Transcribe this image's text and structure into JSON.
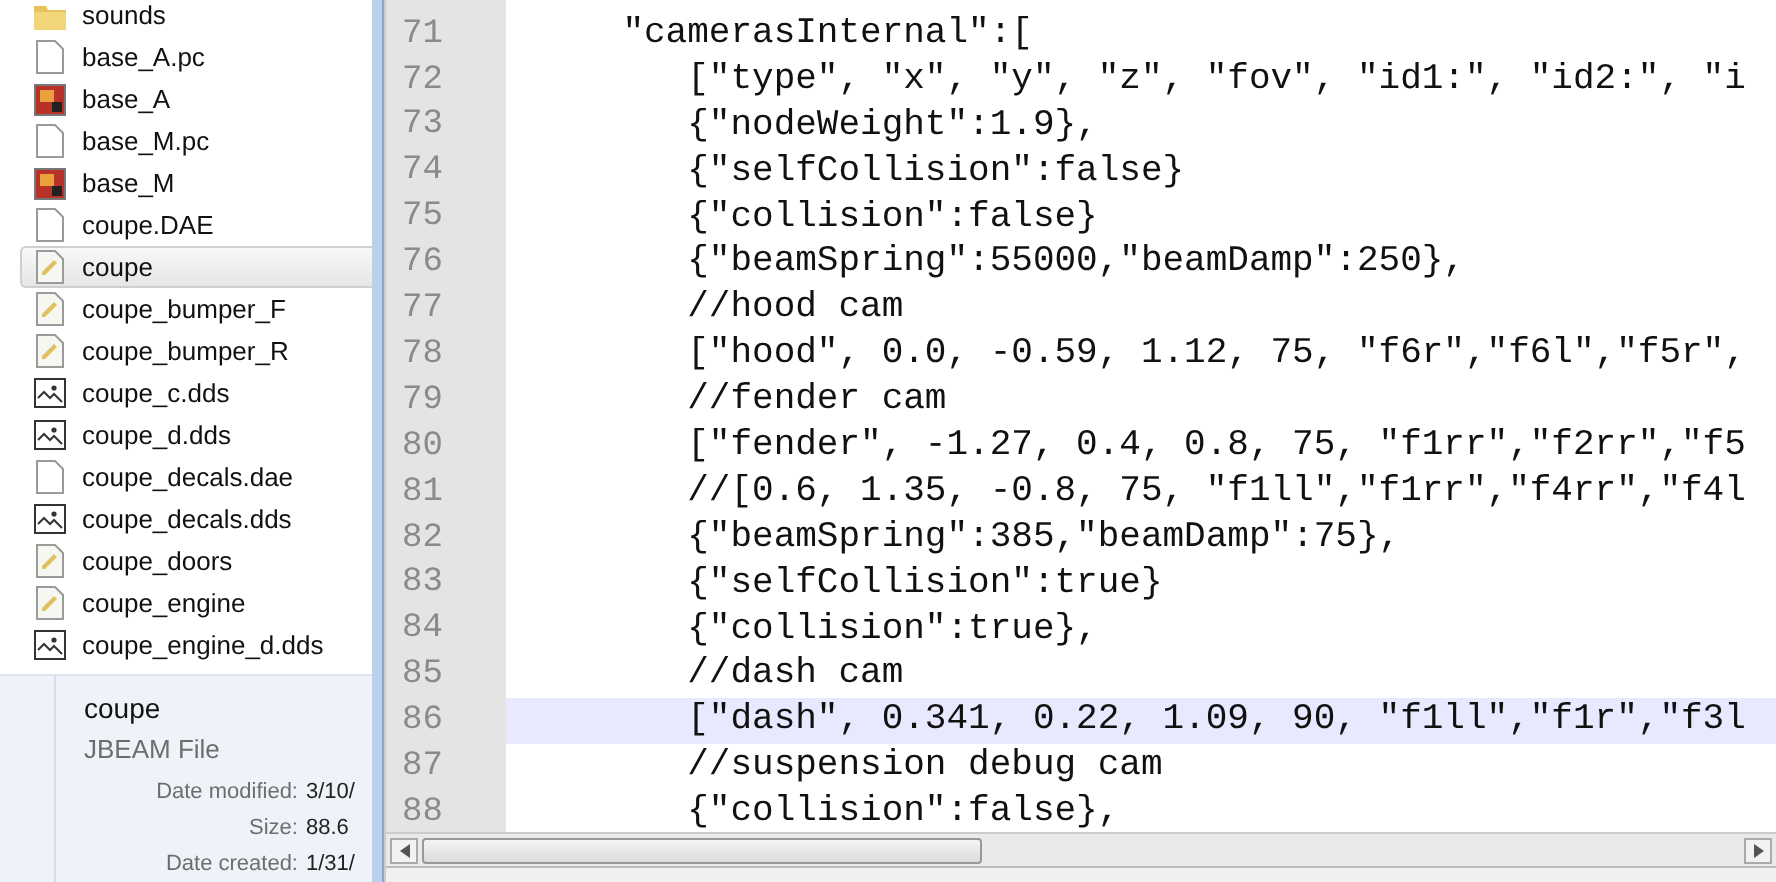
{
  "explorer": {
    "files": [
      {
        "name": "sounds",
        "kind": "folder",
        "selected": false
      },
      {
        "name": "base_A.pc",
        "kind": "file",
        "selected": false
      },
      {
        "name": "base_A",
        "kind": "bitmap",
        "selected": false
      },
      {
        "name": "base_M.pc",
        "kind": "file",
        "selected": false
      },
      {
        "name": "base_M",
        "kind": "bitmap",
        "selected": false
      },
      {
        "name": "coupe.DAE",
        "kind": "file",
        "selected": false
      },
      {
        "name": "coupe",
        "kind": "text",
        "selected": true
      },
      {
        "name": "coupe_bumper_F",
        "kind": "text",
        "selected": false
      },
      {
        "name": "coupe_bumper_R",
        "kind": "text",
        "selected": false
      },
      {
        "name": "coupe_c.dds",
        "kind": "image",
        "selected": false
      },
      {
        "name": "coupe_d.dds",
        "kind": "image",
        "selected": false
      },
      {
        "name": "coupe_decals.dae",
        "kind": "file",
        "selected": false
      },
      {
        "name": "coupe_decals.dds",
        "kind": "image",
        "selected": false
      },
      {
        "name": "coupe_doors",
        "kind": "text",
        "selected": false
      },
      {
        "name": "coupe_engine",
        "kind": "text",
        "selected": false
      },
      {
        "name": "coupe_engine_d.dds",
        "kind": "image",
        "selected": false
      }
    ],
    "details": {
      "name": "coupe",
      "type": "JBEAM File",
      "fields": [
        {
          "label": "Date modified:",
          "value": "3/10/"
        },
        {
          "label": "Size:",
          "value": "88.6"
        },
        {
          "label": "Date created:",
          "value": "1/31/"
        }
      ]
    }
  },
  "editor": {
    "lines": [
      {
        "number": "71",
        "code": "    \"camerasInternal\":[",
        "current": false
      },
      {
        "number": "72",
        "code": "       [\"type\", \"x\", \"y\", \"z\", \"fov\", \"id1:\", \"id2:\", \"i",
        "current": false
      },
      {
        "number": "73",
        "code": "       {\"nodeWeight\":1.9},",
        "current": false
      },
      {
        "number": "74",
        "code": "       {\"selfCollision\":false}",
        "current": false
      },
      {
        "number": "75",
        "code": "       {\"collision\":false}",
        "current": false
      },
      {
        "number": "76",
        "code": "       {\"beamSpring\":55000,\"beamDamp\":250},",
        "current": false
      },
      {
        "number": "77",
        "code": "       //hood cam",
        "current": false
      },
      {
        "number": "78",
        "code": "       [\"hood\", 0.0, -0.59, 1.12, 75, \"f6r\",\"f6l\",\"f5r\",",
        "current": false
      },
      {
        "number": "79",
        "code": "       //fender cam",
        "current": false
      },
      {
        "number": "80",
        "code": "       [\"fender\", -1.27, 0.4, 0.8, 75, \"f1rr\",\"f2rr\",\"f5",
        "current": false
      },
      {
        "number": "81",
        "code": "       //[0.6, 1.35, -0.8, 75, \"f1ll\",\"f1rr\",\"f4rr\",\"f4l",
        "current": false
      },
      {
        "number": "82",
        "code": "       {\"beamSpring\":385,\"beamDamp\":75},",
        "current": false
      },
      {
        "number": "83",
        "code": "       {\"selfCollision\":true}",
        "current": false
      },
      {
        "number": "84",
        "code": "       {\"collision\":true},",
        "current": false
      },
      {
        "number": "85",
        "code": "       //dash cam",
        "current": false
      },
      {
        "number": "86",
        "code": "       [\"dash\", 0.341, 0.22, 1.09, 90, \"f1ll\",\"f1r\",\"f3l",
        "current": true
      },
      {
        "number": "87",
        "code": "       //suspension debug cam",
        "current": false
      },
      {
        "number": "88",
        "code": "       {\"collision\":false},",
        "current": false
      }
    ]
  }
}
